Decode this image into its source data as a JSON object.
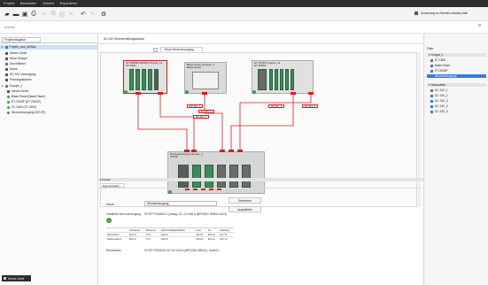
{
  "menu": [
    "Projekt",
    "Bearbeiten",
    "Ansicht",
    "Exportieren"
  ],
  "account_label": "Anmeldung an Siemens Industry Mall",
  "search": {
    "placeholder": "Suchen"
  },
  "left": {
    "tab": "Projektnavigation",
    "root": "Projekt_new_5e9dfc",
    "items": [
      {
        "label": "Neues Gerät",
        "color": "#555555"
      },
      {
        "label": "Neue Gruppe",
        "color": "#555555"
      },
      {
        "label": "Durchführen",
        "color": "#3a7bd5"
      },
      {
        "label": "Netze",
        "color": "#555555"
      },
      {
        "label": "DC 24V Versorgung",
        "color": "#555555"
      },
      {
        "label": "Planungsskizzen",
        "color": "#555555"
      }
    ],
    "group": "Gruppe_1",
    "group_items": [
      {
        "label": "Neues Gerät",
        "color": "#555555"
      },
      {
        "label": "Basis Panel (Basis Panel)",
        "color": "#3e9a4e"
      },
      {
        "label": "ET 200SP (ET 200SP)",
        "color": "#3e9a4e"
      },
      {
        "label": "S7-1500 (S7-1500)",
        "color": "#3e9a4e"
      },
      {
        "label": "Stromversorgung (SITOP)",
        "color": "#3e9a4e"
      }
    ],
    "bottom_button": "Neues Gerät"
  },
  "center": {
    "breadcrumb": "DC 24V Stromverteilungsansicht",
    "tab": "Neue Stromversorgung",
    "devices": [
      {
        "label": "S7-1500/ET200MP Gruppe_11\nS7-1500"
      },
      {
        "label": "Basis Panel (Gruppe_1\nBasis Panel"
      },
      {
        "label": "ET 200SP Gruppe_11\nET 200SP"
      },
      {
        "label": "Stromversorgung Gruppe_1\nSITOP"
      }
    ],
    "connectors": [
      "DC 24V_1",
      "DC 24V_2",
      "DC 24V_3",
      "DC 24V_4",
      "DC 24V_5"
    ]
  },
  "props": {
    "header": "Details",
    "tab": "Eigenschaften",
    "name_label": "Name:",
    "name_value": "Stromversorgung",
    "product_label": "Gewählte Stromversorgung:",
    "product_value": "SITOP PSU8200 1 phasig, DC 24 V/40 A (6EP3437-8SB00-0AY0)",
    "delete_button": "Entfernen",
    "select_button": "Auswählen",
    "table": {
      "headers": [
        "",
        "Gebrauch",
        "Reserve",
        "Gleichzeitigkeitsfaktor",
        "Last",
        "Ist",
        "Zulässig"
      ],
      "rows": [
        [
          "Nennstrom",
          "30,0 A",
          "0 %",
          "100 %",
          "30,0 A",
          "40,0 A",
          "13,7 A"
        ],
        [
          "Spitzenstrom",
          "30,0 A",
          "0 %",
          "100 %",
          "30,0 A",
          "40,0 A",
          "13,7 A"
        ]
      ]
    },
    "redundancy_label": "Redundanz:",
    "redundancy_value": "SITOP PSE202U DC 24 V/40 A (6EP1961-3BA21), modell 1"
  },
  "filter": {
    "title": "Filter",
    "groups": [
      {
        "header": "Gruppe_1",
        "items": [
          "S7-1500",
          "Basis Panel",
          "ET 200SP",
          "Stromversorgung"
        ],
        "selected": 3
      },
      {
        "header": "Netzquellen",
        "items": [
          "DC 24V_1",
          "DC 24V_2",
          "DC 24V_3",
          "DC 24V_4",
          "DC 24V_5"
        ],
        "selected": -1
      }
    ]
  },
  "colors": {
    "accent": "#3a7bd5",
    "error": "#d21f1f",
    "module_green": "#3e8a5a",
    "menubar": "#2c2c30"
  }
}
